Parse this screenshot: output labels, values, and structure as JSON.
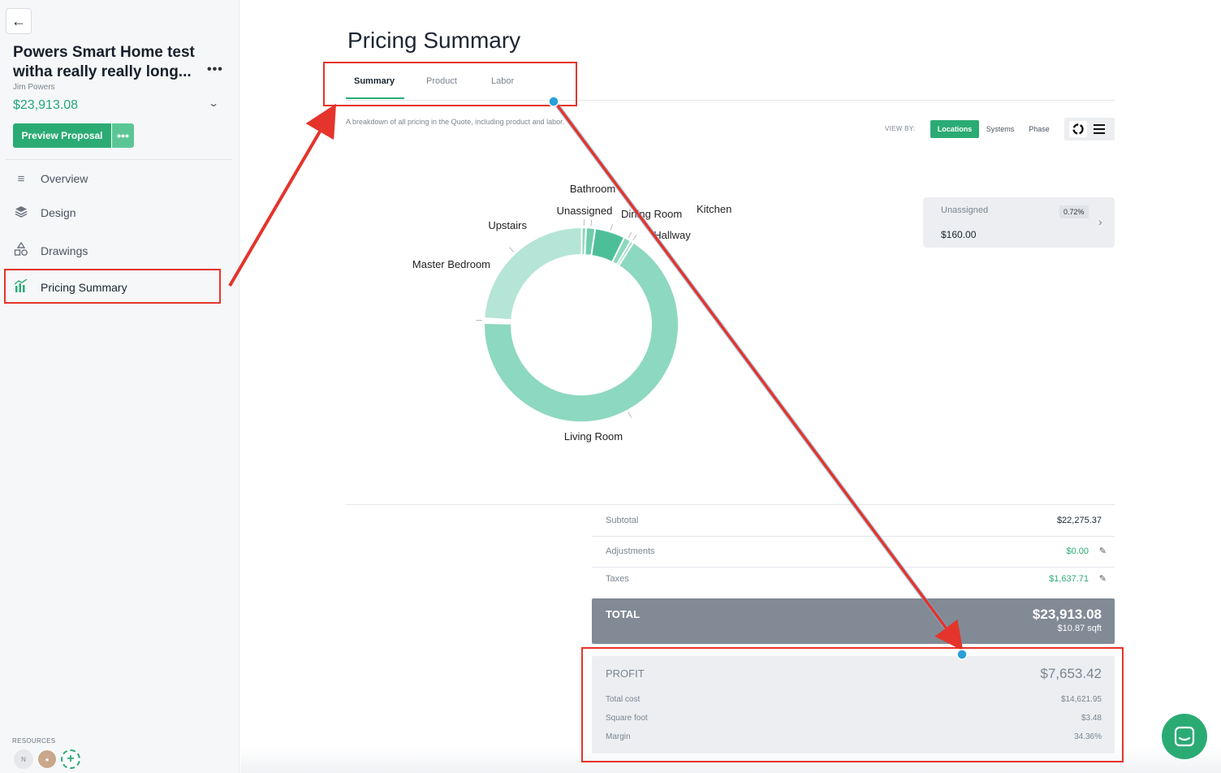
{
  "sidebar": {
    "project_title": "Powers Smart Home test witha really really long...",
    "owner": "Jim Powers",
    "price": "$23,913.08",
    "preview_button": "Preview Proposal",
    "nav": [
      {
        "label": "Overview",
        "icon": "list-icon"
      },
      {
        "label": "Design",
        "icon": "layers-icon"
      },
      {
        "label": "Drawings",
        "icon": "shapes-icon"
      },
      {
        "label": "Pricing Summary",
        "icon": "bar-chart-icon"
      }
    ],
    "resources_label": "RESOURCES",
    "avatar_initials": "N"
  },
  "main": {
    "title": "Pricing Summary",
    "tabs": [
      "Summary",
      "Product",
      "Labor"
    ],
    "description": "A breakdown of all pricing in the Quote, including product and labor.",
    "view_by": {
      "label": "VIEW BY:",
      "options": [
        "Locations",
        "Systems",
        "Phase"
      ],
      "selected": "Locations"
    },
    "selected_card": {
      "name": "Unassigned",
      "percent": "0.72%",
      "amount": "$160.00"
    }
  },
  "chart_data": {
    "type": "pie",
    "donut": true,
    "categories": [
      "Living Room",
      "Master Bedroom",
      "Upstairs",
      "Unassigned",
      "Bathroom",
      "Dining Room",
      "Kitchen",
      "Hallway"
    ],
    "values": [
      66.3,
      0.8,
      24.0,
      0.72,
      1.5,
      5.0,
      1.2,
      0.5
    ],
    "colors": [
      "#8dd8c0",
      "#ffffff",
      "#b5e5d6",
      "#8dd8c0",
      "#6fcdae",
      "#4dbf98",
      "#8dd8c0",
      "#8dd8c0"
    ]
  },
  "totals": {
    "subtotal_label": "Subtotal",
    "subtotal": "$22,275.37",
    "adjustments_label": "Adjustments",
    "adjustments": "$0.00",
    "taxes_label": "Taxes",
    "taxes": "$1,637.71",
    "total_label": "TOTAL",
    "total": "$23,913.08",
    "per_sqft": "$10.87 sqft"
  },
  "profit": {
    "label": "PROFIT",
    "value": "$7,653.42",
    "total_cost_label": "Total cost",
    "total_cost": "$14,621.95",
    "sqft_label": "Square foot",
    "sqft": "$3.48",
    "margin_label": "Margin",
    "margin": "34.36%"
  },
  "colors": {
    "accent": "#2bab74",
    "annotation": "#e5342b",
    "total_bar": "#818a95"
  }
}
